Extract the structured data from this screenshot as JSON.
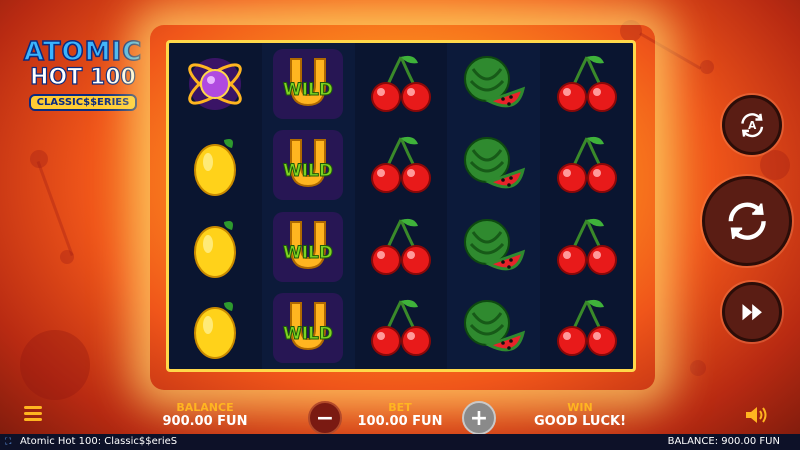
{
  "logo": {
    "line1": "ATOMIC",
    "line2": "HOT 100",
    "line3": "CLASSIC$$ERIES"
  },
  "reels": [
    [
      "atom-icon",
      "lemon-icon",
      "lemon-icon",
      "lemon-icon"
    ],
    [
      "wild-horseshoe-icon",
      "wild-horseshoe-icon",
      "wild-horseshoe-icon",
      "wild-horseshoe-icon"
    ],
    [
      "cherry-icon",
      "cherry-icon",
      "cherry-icon",
      "cherry-icon"
    ],
    [
      "watermelon-icon",
      "watermelon-icon",
      "watermelon-icon",
      "watermelon-icon"
    ],
    [
      "cherry-icon",
      "cherry-icon",
      "cherry-icon",
      "cherry-icon"
    ]
  ],
  "wild_text": "WILD",
  "controls": {
    "autoplay_letter": "A",
    "autoplay_icon": "autoplay-icon",
    "spin_icon": "spin-icon",
    "turbo_icon": "fast-forward-icon",
    "menu_icon": "menu-icon",
    "sound_icon": "speaker-icon",
    "minus": "−",
    "plus": "+"
  },
  "balance": {
    "label": "BALANCE",
    "value": "900.00 FUN"
  },
  "bet": {
    "label": "BET",
    "value": "100.00 FUN"
  },
  "win": {
    "label": "WIN",
    "value": "GOOD LUCK!"
  },
  "status_bar": {
    "game_title": "Atomic Hot 100: Classic$$erieS",
    "balance": "BALANCE: 900.00 FUN"
  },
  "colors": {
    "accent": "#ffb520",
    "frame": "#ffd84a",
    "reel_bg": "#0a1530",
    "button_bg": "#5a1d14"
  }
}
